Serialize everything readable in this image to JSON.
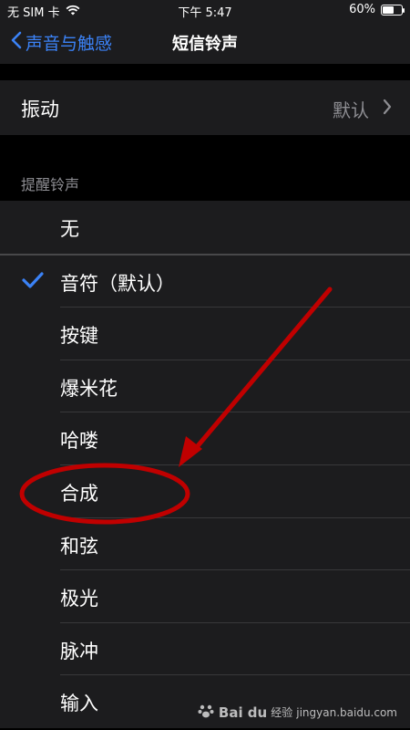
{
  "status_bar": {
    "carrier": "无 SIM 卡",
    "time": "下午 5:47",
    "battery": "60%",
    "battery_level": 0.6,
    "wifi_icon": "wifi-icon"
  },
  "nav": {
    "back_label": "声音与触感",
    "title": "短信铃声"
  },
  "vibration": {
    "label": "振动",
    "value": "默认"
  },
  "section": {
    "header": "提醒铃声"
  },
  "list": {
    "none_item": "无",
    "items": [
      {
        "label": "音符（默认）",
        "selected": true
      },
      {
        "label": "按键"
      },
      {
        "label": "爆米花"
      },
      {
        "label": "哈喽"
      },
      {
        "label": "合成",
        "highlighted": true
      },
      {
        "label": "和弦"
      },
      {
        "label": "极光"
      },
      {
        "label": "脉冲"
      },
      {
        "label": "输入"
      }
    ]
  },
  "colors": {
    "accent": "#3b82f6",
    "annotation": "#c00000"
  },
  "watermark": {
    "brand": "Bai du",
    "suffix": "经验",
    "url": "jingyan.baidu.com"
  }
}
